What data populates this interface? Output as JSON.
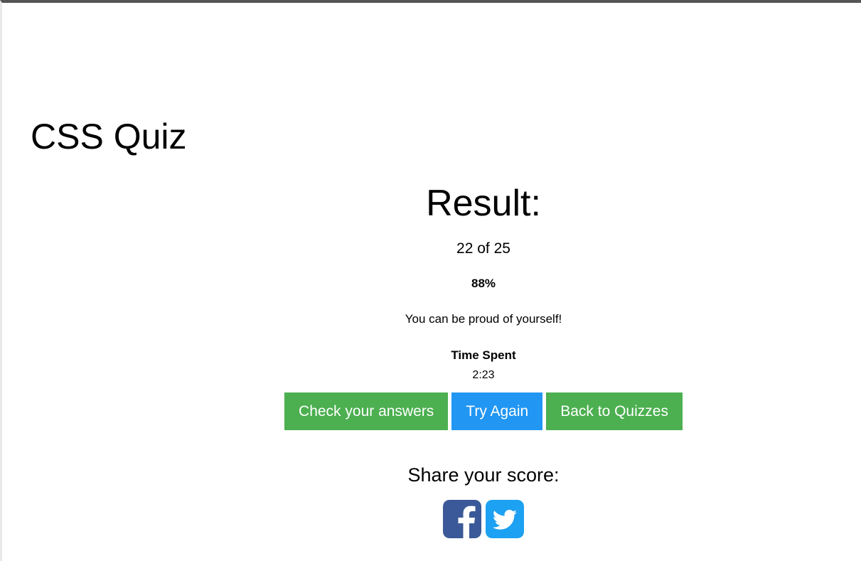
{
  "page": {
    "title": "CSS Quiz"
  },
  "result": {
    "heading": "Result:",
    "score_text": "22 of 25",
    "percent_text": "88%",
    "message": "You can be proud of yourself!",
    "time_label": "Time Spent",
    "time_value": "2:23"
  },
  "actions": {
    "check_answers_label": "Check your answers",
    "try_again_label": "Try Again",
    "back_to_quizzes_label": "Back to Quizzes"
  },
  "share": {
    "heading": "Share your score:",
    "icons": [
      "facebook-icon",
      "twitter-icon"
    ]
  },
  "colors": {
    "green_button": "#4caf50",
    "blue_button": "#2196f3",
    "facebook": "#3b5998",
    "twitter": "#1da1f2",
    "top_bar": "#555555"
  }
}
